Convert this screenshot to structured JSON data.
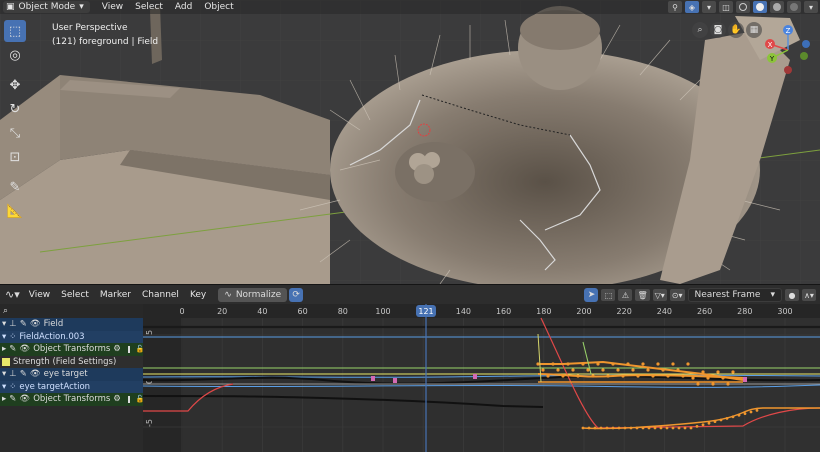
{
  "viewport": {
    "mode": "Object Mode",
    "menu": [
      "View",
      "Select",
      "Add",
      "Object"
    ],
    "overlay_title": "User Perspective",
    "overlay_subtitle": "(121) foreground | Field",
    "gizmo": {
      "z": "Z",
      "y": "Y",
      "x": "X"
    },
    "tool_icons": [
      "select-box-icon",
      "cursor-icon",
      "move-icon",
      "rotate-icon",
      "scale-icon",
      "transform-icon",
      "annotate-icon",
      "measure-icon"
    ],
    "nav_icons": [
      "zoom-icon",
      "camera-icon",
      "pan-icon",
      "grid-icon"
    ]
  },
  "graph_editor": {
    "menu": [
      "View",
      "Select",
      "Marker",
      "Channel",
      "Key"
    ],
    "normalize_label": "Normalize",
    "snap_option": "Nearest Frame",
    "current_frame": "121",
    "frame_ticks": [
      "0",
      "20",
      "40",
      "60",
      "80",
      "100",
      "120",
      "140",
      "160",
      "180",
      "200",
      "220",
      "240",
      "260",
      "280",
      "300"
    ],
    "value_ticks": [
      "5",
      "0",
      "-5"
    ],
    "channels": [
      {
        "label": "Field",
        "kind": "object"
      },
      {
        "label": "FieldAction.003",
        "kind": "action"
      },
      {
        "label": "Object Transforms",
        "kind": "group"
      },
      {
        "label": "Strength (Field Settings)",
        "kind": "fcurve",
        "color": "#e8e86a"
      },
      {
        "label": "eye target",
        "kind": "object"
      },
      {
        "label": "eye targetAction",
        "kind": "action"
      },
      {
        "label": "Object Transforms",
        "kind": "group"
      }
    ],
    "accent": "#4772b3",
    "curve_colors": {
      "orange": "#f0962e",
      "red": "#e04848",
      "blue": "#5a9ee6",
      "green": "#9ad46a",
      "yellow": "#e8e86a",
      "pink": "#d46ab4"
    }
  }
}
